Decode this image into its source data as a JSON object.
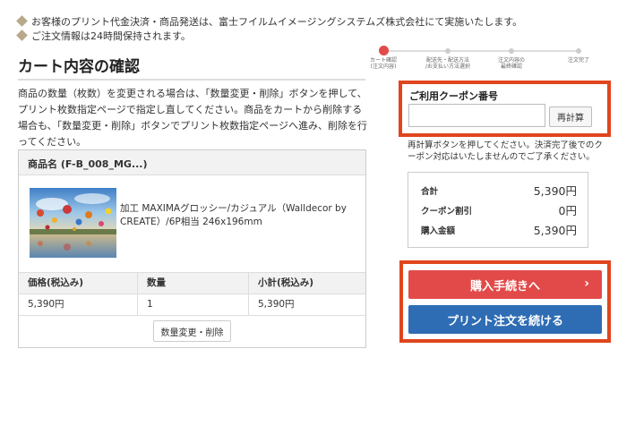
{
  "notices": [
    "お客様のプリント代金決済・商品発送は、富士フイルムイメージングシステムズ株式会社にて実施いたします。",
    "ご注文情報は24時間保持されます。"
  ],
  "page_title": "カート内容の確認",
  "steps": [
    {
      "label": "カート確認",
      "sub": "(注文内容)",
      "active": true
    },
    {
      "label": "配送先・配送方法",
      "sub": "/お支払い方法選択",
      "active": false
    },
    {
      "label": "注文内容の",
      "sub": "最終確認",
      "active": false
    },
    {
      "label": "注文完了",
      "sub": "",
      "active": false
    }
  ],
  "description": "商品の数量（枚数）を変更される場合は、「数量変更・削除」ボタンを押して、プリント枚数指定ページで指定し直してください。商品をカートから削除する場合も、「数量変更・削除」ボタンでプリント枚数指定ページへ進み、削除を行ってください。",
  "cart": {
    "product_header": "商品名 (F-B_008_MG...)",
    "product_name": "加工 MAXIMAグロッシー/カジュアル（Walldecor by CREATE）/6P相当 246x196mm",
    "table_headers": [
      "価格(税込み)",
      "数量",
      "小計(税込み)"
    ],
    "table_row": [
      "5,390円",
      "1",
      "5,390円"
    ],
    "qty_button": "数量変更・削除"
  },
  "coupon": {
    "label": "ご利用クーポン番号",
    "input_value": "",
    "recalc_button": "再計算",
    "note": "再計算ボタンを押してください。決済完了後でのクーポン対応はいたしませんのでご了承ください。"
  },
  "summary": {
    "rows": [
      {
        "label": "合計",
        "value": "5,390円"
      },
      {
        "label": "クーポン割引",
        "value": "0円"
      },
      {
        "label": "購入金額",
        "value": "5,390円"
      }
    ]
  },
  "actions": {
    "buy_label": "購入手続きへ",
    "buy_chevron": "›",
    "continue_label": "プリント注文を続ける"
  },
  "colors": {
    "accent_red": "#e24a4a",
    "highlight_border": "#e0451d",
    "blue": "#2e6db4"
  }
}
